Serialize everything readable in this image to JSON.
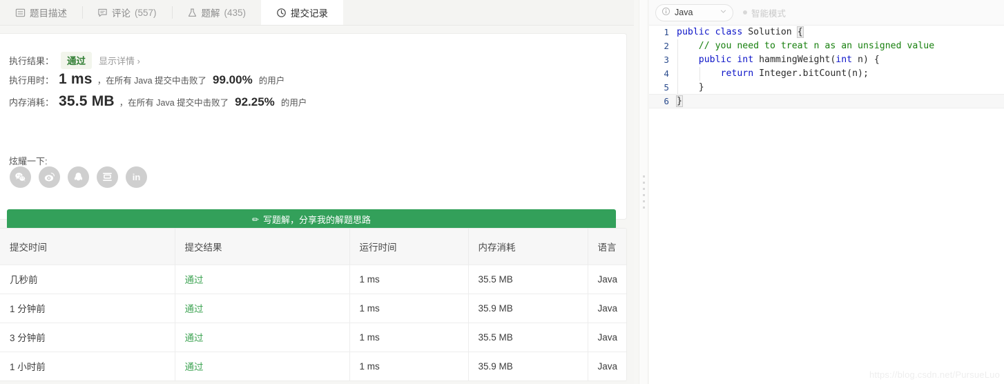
{
  "tabs": [
    {
      "label": "题目描述",
      "icon": "description-icon",
      "count": "",
      "active": false
    },
    {
      "label": "评论",
      "icon": "comment-icon",
      "count": " (557)",
      "active": false
    },
    {
      "label": "题解",
      "icon": "flask-icon",
      "count": "(435)",
      "active": false
    },
    {
      "label": "提交记录",
      "icon": "clock-icon",
      "count": "",
      "active": true
    }
  ],
  "result": {
    "status_label": "执行结果：",
    "status_value": "通过",
    "show_detail": "显示详情 ›",
    "runtime_label": "执行用时：",
    "runtime_value": "1 ms",
    "runtime_note_pre": "，在所有 Java 提交中击败了",
    "runtime_percent": "99.00%",
    "runtime_note_post": "的用户",
    "memory_label": "内存消耗：",
    "memory_value": "35.5 MB",
    "memory_note_pre": "，在所有 Java 提交中击败了",
    "memory_percent": "92.25%",
    "memory_note_post": "的用户",
    "flaunt_label": "炫耀一下:",
    "share_icons": [
      {
        "name": "wechat-icon",
        "glyph": ""
      },
      {
        "name": "weibo-icon",
        "glyph": ""
      },
      {
        "name": "qq-icon",
        "glyph": ""
      },
      {
        "name": "douban-icon",
        "glyph": "豆"
      },
      {
        "name": "linkedin-icon",
        "glyph": "in"
      }
    ],
    "write_solution_button": "写题解，分享我的解题思路",
    "pencil_glyph": "✏",
    "accent_green": "#33a05a",
    "pass_text_color": "#2f7d32"
  },
  "submissions": {
    "columns": [
      "提交时间",
      "提交结果",
      "运行时间",
      "内存消耗",
      "语言"
    ],
    "rows": [
      {
        "time": "几秒前",
        "result": "通过",
        "runtime": "1 ms",
        "memory": "35.5 MB",
        "lang": "Java"
      },
      {
        "time": "1 分钟前",
        "result": "通过",
        "runtime": "1 ms",
        "memory": "35.9 MB",
        "lang": "Java"
      },
      {
        "time": "3 分钟前",
        "result": "通过",
        "runtime": "1 ms",
        "memory": "35.5 MB",
        "lang": "Java"
      },
      {
        "time": "1 小时前",
        "result": "通过",
        "runtime": "1 ms",
        "memory": "35.9 MB",
        "lang": "Java"
      }
    ]
  },
  "editor": {
    "language": "Java",
    "smart_mode": "智能模式",
    "lines": [
      {
        "no": "1",
        "text": "public class Solution {"
      },
      {
        "no": "2",
        "text": "    // you need to treat n as an unsigned value"
      },
      {
        "no": "3",
        "text": "    public int hammingWeight(int n) {"
      },
      {
        "no": "4",
        "text": "        return Integer.bitCount(n);"
      },
      {
        "no": "5",
        "text": "    }"
      },
      {
        "no": "6",
        "text": "}"
      }
    ],
    "keyword_color": "#0c14c8",
    "comment_color": "#18800f",
    "linenumber_color": "#2a4b8d"
  },
  "watermark": "https://blog.csdn.net/PursueLuo"
}
